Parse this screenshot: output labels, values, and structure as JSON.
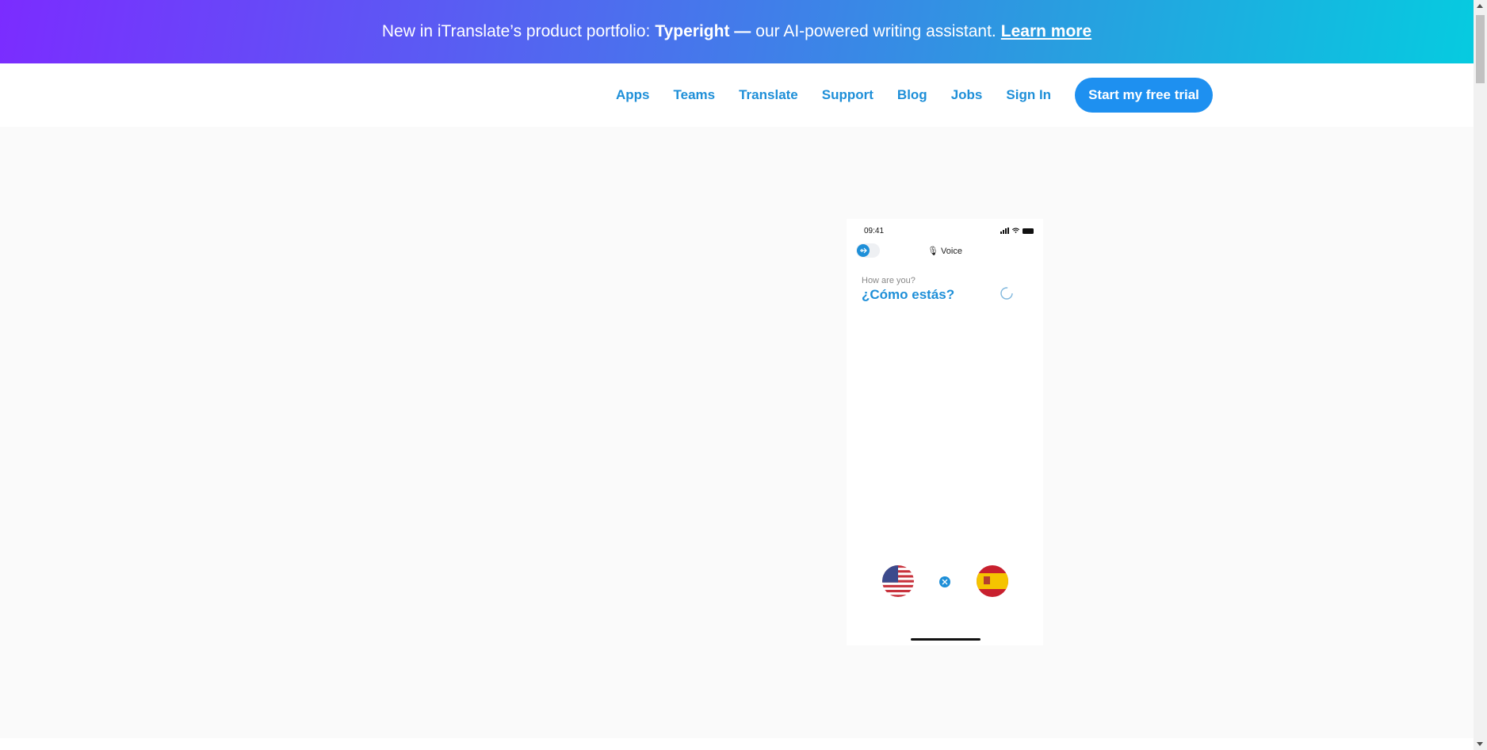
{
  "banner": {
    "prefix": "New in iTranslate’s product portfolio:",
    "product": "Typeright —",
    "suffix": "our AI-powered writing assistant.",
    "link": "Learn more"
  },
  "nav": {
    "items": [
      "Apps",
      "Teams",
      "Translate",
      "Support",
      "Blog",
      "Jobs",
      "Sign In"
    ],
    "cta": "Start my free trial"
  },
  "phone": {
    "time": "09:41",
    "mode": "Voice",
    "source_text": "How are you?",
    "target_text": "¿Cómo estás?",
    "source_flag": "us-flag-icon",
    "target_flag": "spain-flag-icon"
  },
  "colors": {
    "brand_blue": "#1e8fd8",
    "cta_blue": "#1e90f0",
    "banner_start": "#7b2cff",
    "banner_end": "#06cbe0"
  }
}
